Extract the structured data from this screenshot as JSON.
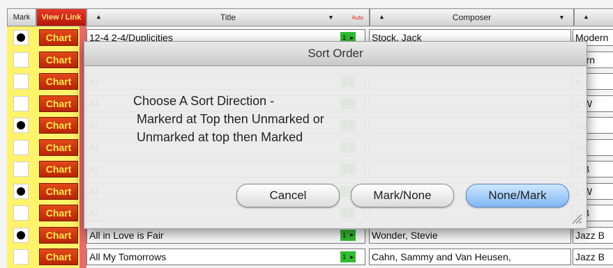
{
  "header": {
    "mark": "Mark",
    "view_link": "View / Link",
    "title": "Title",
    "auto": "Auto",
    "composer": "Composer",
    "sort_up": "▲",
    "sort_down": "▼"
  },
  "rows": [
    {
      "marked": true,
      "chart": "Chart",
      "title": "12-4 2-4/Duplicities",
      "composer": "Stock, Jack",
      "genre": "Modern"
    },
    {
      "marked": false,
      "chart": "Chart",
      "title": "Sc",
      "composer": "",
      "genre": "dern"
    },
    {
      "marked": false,
      "chart": "Chart",
      "title": "Al",
      "composer": "",
      "genre": "n"
    },
    {
      "marked": false,
      "chart": "Chart",
      "title": "Al",
      "composer": "",
      "genre": "z W"
    },
    {
      "marked": true,
      "chart": "Chart",
      "title": "Al",
      "composer": "",
      "genre": "ng"
    },
    {
      "marked": false,
      "chart": "Chart",
      "title": "Al",
      "composer": "",
      "genre": "ng"
    },
    {
      "marked": false,
      "chart": "Chart",
      "title": "Al",
      "composer": "",
      "genre": "z B"
    },
    {
      "marked": true,
      "chart": "Chart",
      "title": "Al",
      "composer": "",
      "genre": "z W"
    },
    {
      "marked": false,
      "chart": "Chart",
      "title": "Al",
      "composer": "",
      "genre": "z B"
    },
    {
      "marked": true,
      "chart": "Chart",
      "title": "All in Love is Fair",
      "composer": "Wonder, Stevie",
      "genre": "Jazz B"
    },
    {
      "marked": false,
      "chart": "Chart",
      "title": "All My Tomorrows",
      "composer": "Cahn, Sammy and Van Heusen,",
      "genre": "Jazz B"
    }
  ],
  "dialog": {
    "title": "Sort Order",
    "message_lines": [
      "Choose A Sort Direction -",
      " Markerd at Top then Unmarked or",
      " Unmarked at top then Marked"
    ],
    "cancel_label": "Cancel",
    "mark_none_label": "Mark/None",
    "none_mark_label": "None/Mark"
  },
  "icons": {
    "key_badge": "green-key-badge",
    "resize": "resize-grip-icon"
  },
  "colors": {
    "mark_column": "#fff36b",
    "chart_button": "#d0300f",
    "chart_text": "#ffe84e",
    "default_button": "#7fb7f4"
  }
}
